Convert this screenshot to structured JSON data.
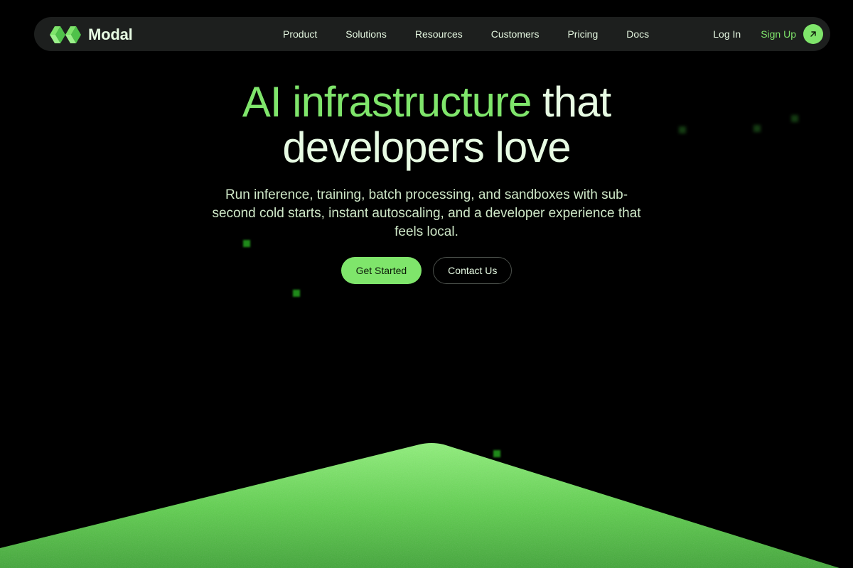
{
  "brand": {
    "name": "Modal",
    "logo_icon": "modal-logo-icon",
    "accent_color": "#7fe56b"
  },
  "nav": {
    "links": [
      "Product",
      "Solutions",
      "Resources",
      "Customers",
      "Pricing",
      "Docs"
    ],
    "login_label": "Log In",
    "signup_label": "Sign Up",
    "signup_icon": "arrow-up-right-icon"
  },
  "hero": {
    "headline_accent": "AI infrastructure",
    "headline_rest_1": "that",
    "headline_rest_2": "developers love",
    "subtitle": "Run inference, training, batch processing, and sandboxes with sub-second cold starts, instant autoscaling, and a developer experience that feels local.",
    "primary_cta": "Get Started",
    "secondary_cta": "Contact Us"
  }
}
